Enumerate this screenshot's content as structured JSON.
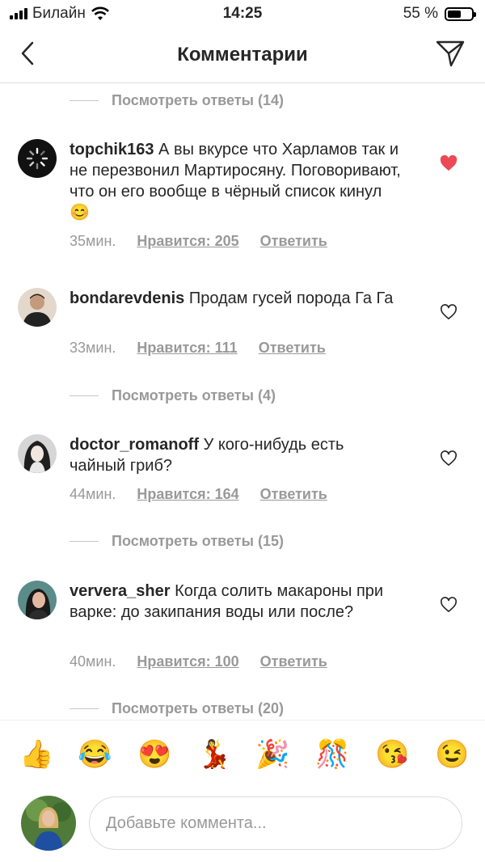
{
  "status_bar": {
    "carrier": "Билайн",
    "time": "14:25",
    "battery": "55 %"
  },
  "header": {
    "title": "Комментарии",
    "back_icon": "chevron-left-icon",
    "send_icon": "paper-plane-icon"
  },
  "view_replies": [
    {
      "label": "Посмотреть ответы (14)"
    },
    {
      "label": "Посмотреть ответы (4)"
    },
    {
      "label": "Посмотреть ответы (15)"
    },
    {
      "label": "Посмотреть ответы (20)"
    }
  ],
  "comments": [
    {
      "username": "topchik163",
      "text": "А вы вкурсе что Харламов так и не перезвонил Мартиросяну. Поговоривают, что он его вообще в чёрный список кинул😊",
      "time": "35мин.",
      "likes": "Нравится: 205",
      "reply": "Ответить",
      "liked": true
    },
    {
      "username": "bondarevdenis",
      "text": "Продам гусей порода Га Га",
      "time": "33мин.",
      "likes": "Нравится: 111",
      "reply": "Ответить",
      "liked": false
    },
    {
      "username": "doctor_romanoff",
      "text": "У кого-нибудь есть чайный гриб?",
      "time": "44мин.",
      "likes": "Нравится: 164",
      "reply": "Ответить",
      "liked": false
    },
    {
      "username": "ververa_sher",
      "text": "Когда солить макароны при варке: до закипания воды или после?",
      "time": "40мин.",
      "likes": "Нравится: 100",
      "reply": "Ответить",
      "liked": false
    }
  ],
  "emoji_bar": [
    "👍",
    "😂",
    "😍",
    "💃",
    "🎉",
    "🎊",
    "😘",
    "😉"
  ],
  "input": {
    "placeholder": "Добавьте коммента..."
  },
  "colors": {
    "like_red": "#ed4956",
    "muted_gray": "#999999",
    "text": "#262626",
    "divider": "#dbdbdb"
  }
}
